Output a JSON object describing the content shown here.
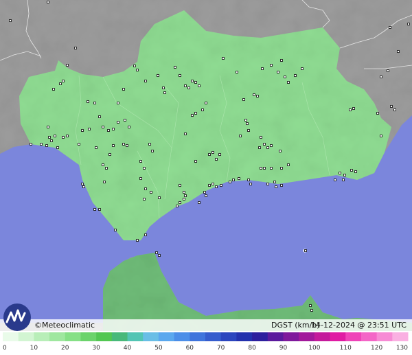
{
  "map": {
    "credit": "©Meteoclimatic",
    "variable": "DGST (km/h)",
    "timestamp": "14-12-2024 @ 23:51 UTC"
  },
  "legend": {
    "tick_labels": [
      "0",
      "10",
      "20",
      "30",
      "40",
      "50",
      "60",
      "70",
      "80",
      "90",
      "100",
      "110",
      "120",
      "130"
    ],
    "bins": [
      0,
      5,
      10,
      15,
      20,
      25,
      30,
      35,
      40,
      45,
      50,
      55,
      60,
      65,
      70,
      75,
      80,
      85,
      90,
      95,
      100,
      105,
      110,
      115,
      120,
      125,
      130
    ],
    "colors": [
      "#e9fbe9",
      "#d2f5d2",
      "#b8eeb8",
      "#9fe79f",
      "#86e086",
      "#6bd36b",
      "#52c752",
      "#48b97a",
      "#52c5b4",
      "#69bee6",
      "#5aa8ee",
      "#4b8ee8",
      "#3f74dc",
      "#355ccd",
      "#2b45be",
      "#2331ad",
      "#2d1f9e",
      "#5a1a9d",
      "#7f199c",
      "#a2199b",
      "#c41a9b",
      "#e01ba3",
      "#ef43b8",
      "#f466c7",
      "#f78bd5",
      "#fab0e2"
    ]
  },
  "colors": {
    "sea": "#7b86dc",
    "land_out": "#9c9c9c",
    "land_andalusia": "#8fdc92",
    "land_africa": "#6fbc78",
    "station": "#222222"
  }
}
